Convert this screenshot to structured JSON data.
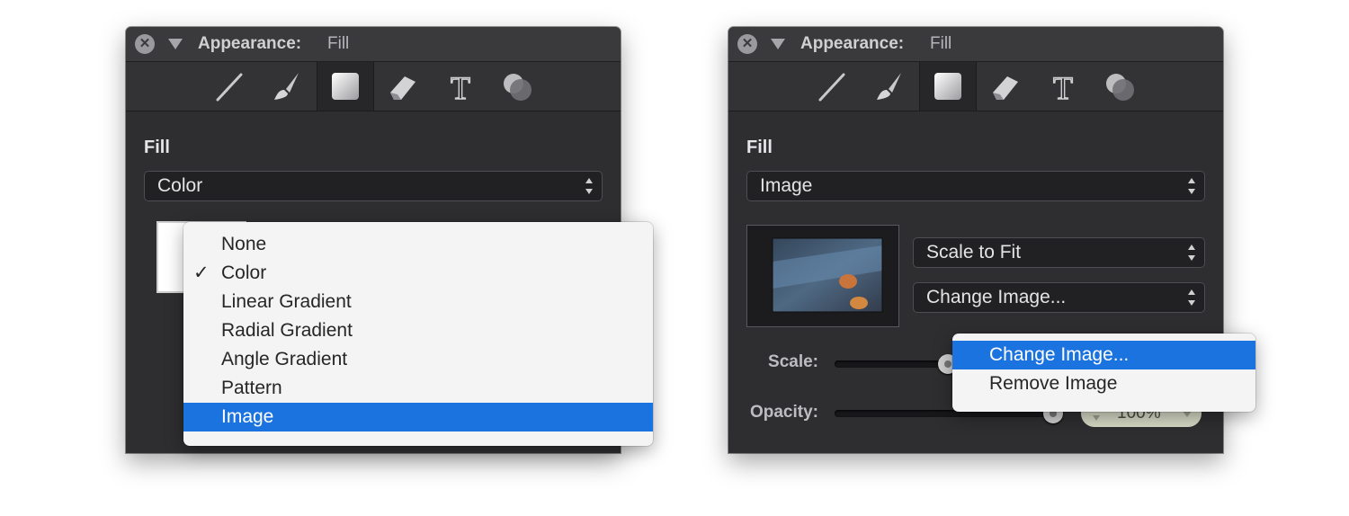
{
  "left_panel": {
    "title": "Appearance:",
    "subtitle": "Fill",
    "fill_heading": "Fill",
    "fill_type_popup": "Color",
    "fill_type_menu": {
      "items": [
        {
          "label": "None",
          "checked": false,
          "highlighted": false
        },
        {
          "label": "Color",
          "checked": true,
          "highlighted": false
        },
        {
          "label": "Linear Gradient",
          "checked": false,
          "highlighted": false
        },
        {
          "label": "Radial Gradient",
          "checked": false,
          "highlighted": false
        },
        {
          "label": "Angle Gradient",
          "checked": false,
          "highlighted": false
        },
        {
          "label": "Pattern",
          "checked": false,
          "highlighted": false
        },
        {
          "label": "Image",
          "checked": false,
          "highlighted": true
        }
      ],
      "check_mark": "✓"
    }
  },
  "right_panel": {
    "title": "Appearance:",
    "subtitle": "Fill",
    "fill_heading": "Fill",
    "fill_type_popup": "Image",
    "scale_mode_popup": "Scale to Fit",
    "change_image_popup": "Change Image...",
    "scale_label": "Scale:",
    "opacity_label": "Opacity:",
    "opacity_value": "100%",
    "image_menu": {
      "items": [
        {
          "label": "Change Image...",
          "highlighted": true
        },
        {
          "label": "Remove Image",
          "highlighted": false
        }
      ]
    }
  },
  "toolbar_icons": [
    "line-tool-icon",
    "brush-tool-icon",
    "fill-tool-icon",
    "eraser-tool-icon",
    "text-tool-icon",
    "shadow-tool-icon"
  ],
  "colors": {
    "panel_bg": "#2e2e31",
    "menu_highlight": "#1b73e0",
    "stepper_bg": "#d7d9c6"
  }
}
